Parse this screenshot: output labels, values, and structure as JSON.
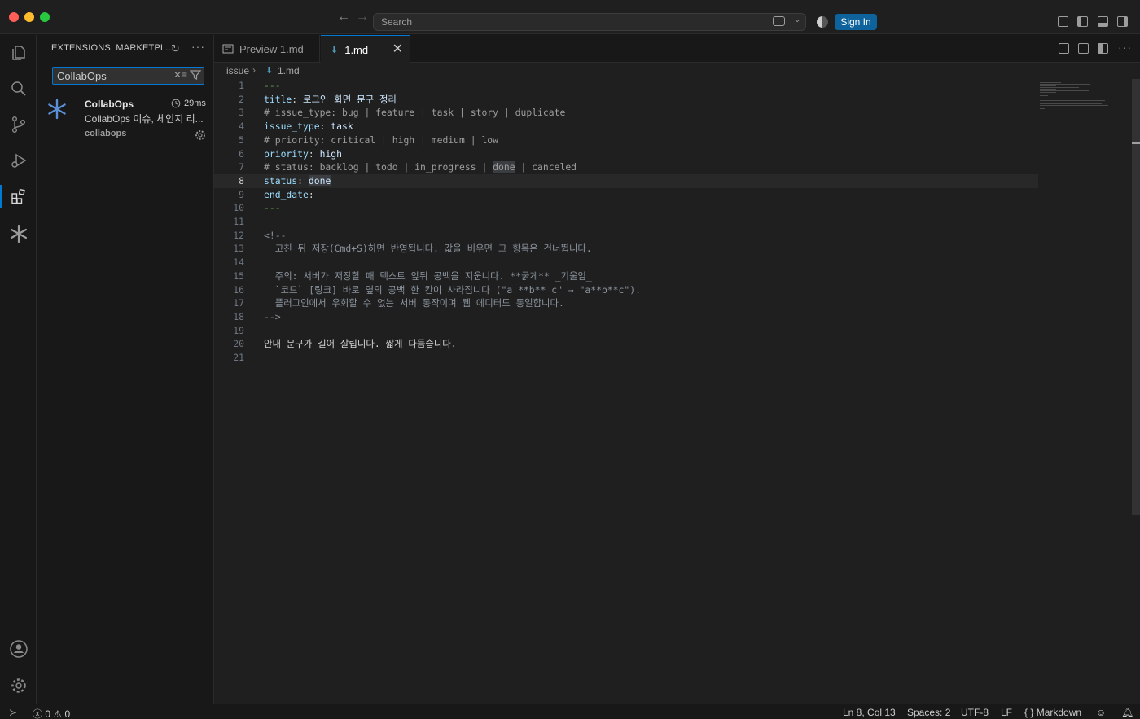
{
  "titlebar": {
    "search_placeholder": "Search",
    "sign_in": "Sign In"
  },
  "sidebar": {
    "title": "EXTENSIONS: MARKETPL...",
    "search_value": "CollabOps",
    "extension": {
      "name": "CollabOps",
      "time": "29ms",
      "description": "CollabOps 이슈, 체인지 리...",
      "publisher": "collabops"
    }
  },
  "tabs": {
    "preview": "Preview 1.md",
    "active": "1.md"
  },
  "breadcrumb": {
    "folder": "issue",
    "file": "1.md"
  },
  "editor": {
    "current_line": 8,
    "lines": [
      {
        "n": "1",
        "segs": [
          [
            "dash",
            "---"
          ]
        ]
      },
      {
        "n": "2",
        "segs": [
          [
            "k",
            "title"
          ],
          [
            "p",
            ": "
          ],
          [
            "vv",
            "로그인 화면 문구 정리"
          ]
        ]
      },
      {
        "n": "3",
        "segs": [
          [
            "c",
            "# issue_type: bug | feature | task | story | duplicate"
          ]
        ]
      },
      {
        "n": "4",
        "segs": [
          [
            "k",
            "issue_type"
          ],
          [
            "p",
            ": "
          ],
          [
            "vv",
            "task"
          ]
        ]
      },
      {
        "n": "5",
        "segs": [
          [
            "c",
            "# priority: critical | high | medium | low"
          ]
        ]
      },
      {
        "n": "6",
        "segs": [
          [
            "k",
            "priority"
          ],
          [
            "p",
            ": "
          ],
          [
            "vv",
            "high"
          ]
        ]
      },
      {
        "n": "7",
        "segs": [
          [
            "c",
            "# status: backlog | todo | in_progress | "
          ],
          [
            "chl",
            "done"
          ],
          [
            "c",
            " | canceled"
          ]
        ]
      },
      {
        "n": "8",
        "segs": [
          [
            "k",
            "status"
          ],
          [
            "p",
            ": "
          ],
          [
            "vhl",
            "done"
          ]
        ]
      },
      {
        "n": "9",
        "segs": [
          [
            "k",
            "end_date"
          ],
          [
            "p",
            ":"
          ]
        ]
      },
      {
        "n": "10",
        "segs": [
          [
            "dash",
            "---"
          ]
        ]
      },
      {
        "n": "11",
        "segs": []
      },
      {
        "n": "12",
        "segs": [
          [
            "cm",
            "<!--"
          ]
        ]
      },
      {
        "n": "13",
        "segs": [
          [
            "cm",
            "  고친 뒤 저장(Cmd+S)하면 반영됩니다. 값을 비우면 그 항목은 건너뜁니다."
          ]
        ]
      },
      {
        "n": "14",
        "segs": []
      },
      {
        "n": "15",
        "segs": [
          [
            "cm",
            "  주의: 서버가 저장할 때 텍스트 앞뒤 공백을 지웁니다. **굵게** _기울임_"
          ]
        ]
      },
      {
        "n": "16",
        "segs": [
          [
            "cm",
            "  `코드` [링크] 바로 옆의 공백 한 칸이 사라집니다 (\"a **b** c\" → \"a**b**c\")."
          ]
        ]
      },
      {
        "n": "17",
        "segs": [
          [
            "cm",
            "  플러그인에서 우회할 수 없는 서버 동작이며 웹 에디터도 동일합니다."
          ]
        ]
      },
      {
        "n": "18",
        "segs": [
          [
            "cm",
            "-->"
          ]
        ]
      },
      {
        "n": "19",
        "segs": []
      },
      {
        "n": "20",
        "segs": [
          [
            "p",
            "안내 문구가 길어 잘립니다. 짧게 다듬습니다."
          ]
        ]
      },
      {
        "n": "21",
        "segs": []
      }
    ]
  },
  "statusbar": {
    "errors": "0",
    "warnings": "0",
    "position": "Ln 8, Col 13",
    "spaces": "Spaces: 2",
    "encoding": "UTF-8",
    "eol": "LF",
    "language": "Markdown"
  }
}
